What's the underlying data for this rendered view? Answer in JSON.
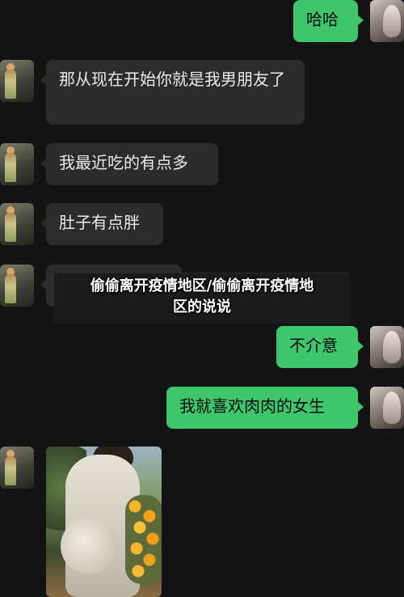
{
  "messages": [
    {
      "side": "right",
      "text": "哈哈"
    },
    {
      "side": "left",
      "text": "那从现在开始你就是我男朋友了"
    },
    {
      "side": "left",
      "text": "我最近吃的有点多"
    },
    {
      "side": "left",
      "text": "肚子有点胖"
    },
    {
      "side": "left",
      "text": ""
    },
    {
      "side": "right",
      "text": "不介意"
    },
    {
      "side": "right",
      "text": "我就喜欢肉肉的女生"
    }
  ],
  "overlay": {
    "line1": "偷偷离开疫情地区/偷偷离开疫情地",
    "line2": "区的说说"
  },
  "colors": {
    "background": "#141414",
    "incoming_bubble": "#2c2c2c",
    "outgoing_bubble": "#3fc56b"
  },
  "icons": {
    "contact_avatar": "photo-avatar",
    "self_avatar": "photo-avatar"
  }
}
